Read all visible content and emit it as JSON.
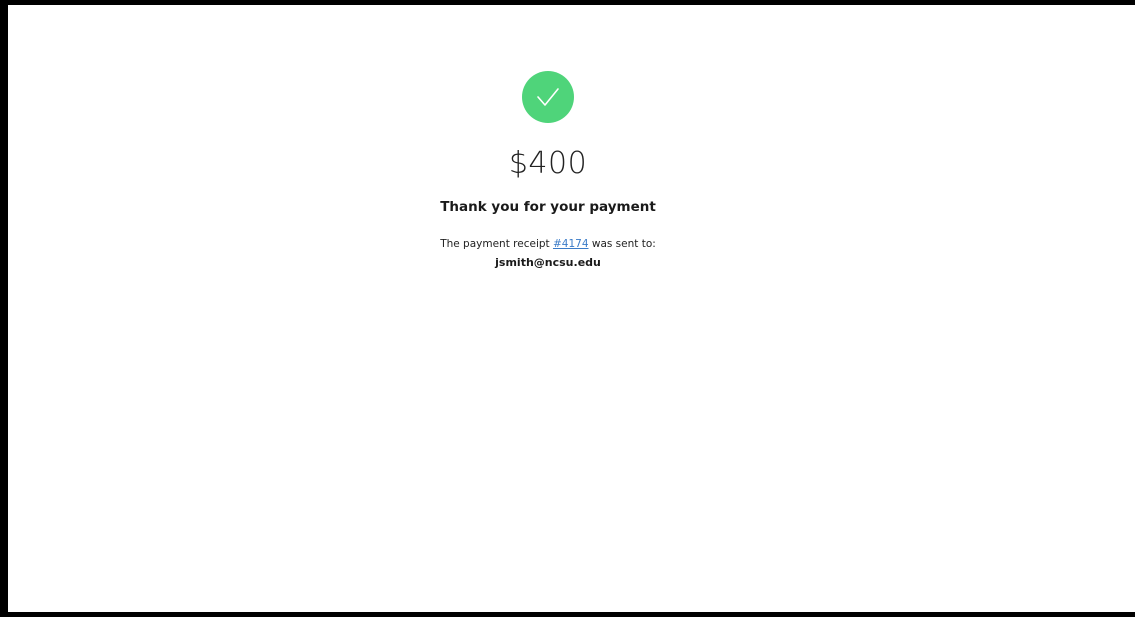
{
  "payment": {
    "amount": "$400",
    "heading": "Thank you for your payment",
    "receipt_prefix": "The payment receipt ",
    "receipt_number": "#4174",
    "receipt_suffix": " was sent to:",
    "email": "jsmith@ncsu.edu",
    "success_icon": "checkmark-icon"
  },
  "colors": {
    "success": "#4fd47a",
    "link": "#3a7bc8"
  }
}
